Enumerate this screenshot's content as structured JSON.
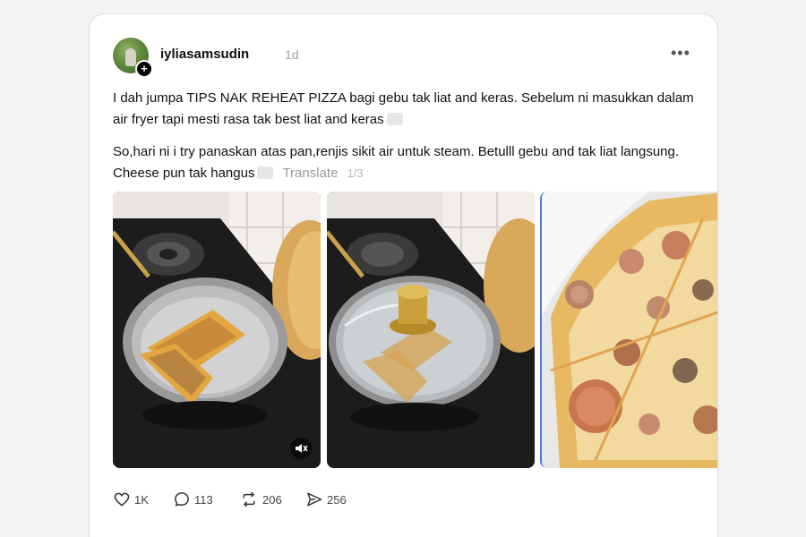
{
  "post": {
    "username": "iyliasamsudin",
    "time_ago": "1d",
    "follow_badge": "+",
    "more": "•••",
    "paragraph_1": "I dah jumpa TIPS NAK REHEAT PIZZA bagi gebu tak liat and keras. Sebelum ni masukkan dalam air fryer tapi mesti rasa tak best liat and keras",
    "paragraph_2": "So,hari ni i try panaskan atas pan,renjis sikit air untuk steam. Betulll gebu and tak liat langsung. Cheese pun tak hangus",
    "translate_label": "Translate",
    "page_counter": "1/3"
  },
  "actions": {
    "likes": "1K",
    "comments": "113",
    "reposts": "206",
    "shares": "256"
  },
  "icons": {
    "more": "more-horizontal-icon",
    "like": "heart-icon",
    "comment": "speech-bubble-icon",
    "repost": "repost-arrows-icon",
    "share": "send-arrow-icon",
    "mute": "mute-speaker-icon"
  },
  "colors": {
    "selected_media_border": "#4a7fd8",
    "text": "#111111",
    "muted_text": "#a0a0a0"
  }
}
